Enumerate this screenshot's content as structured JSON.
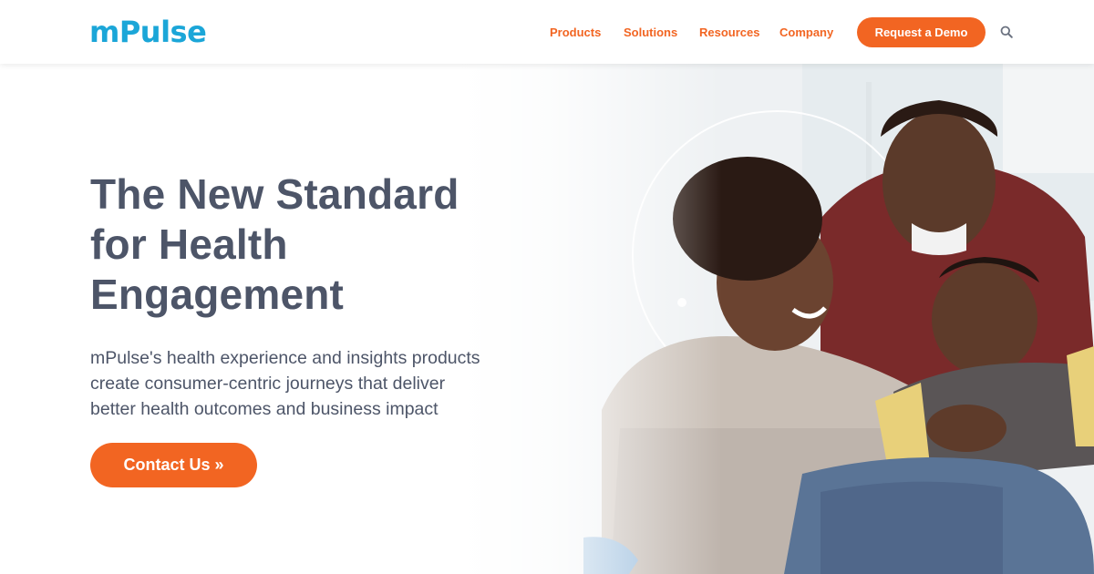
{
  "brand": {
    "logo_text": "mPulse",
    "logo_color": "#1ba6d8",
    "accent_color": "#f26522",
    "text_color": "#4d5568"
  },
  "nav": {
    "items": [
      "Products",
      "Solutions",
      "Resources",
      "Company"
    ],
    "demo_label": "Request a Demo",
    "search_icon": "search-icon"
  },
  "hero": {
    "headline_lines": [
      "The New Standard",
      "for Health",
      "Engagement"
    ],
    "subtext_lines": [
      "mPulse's health experience and insights products",
      "create consumer-centric journeys that deliver",
      "better health outcomes and business impact"
    ],
    "cta_label": "Contact Us »",
    "image_description_icon": "family-photo"
  }
}
